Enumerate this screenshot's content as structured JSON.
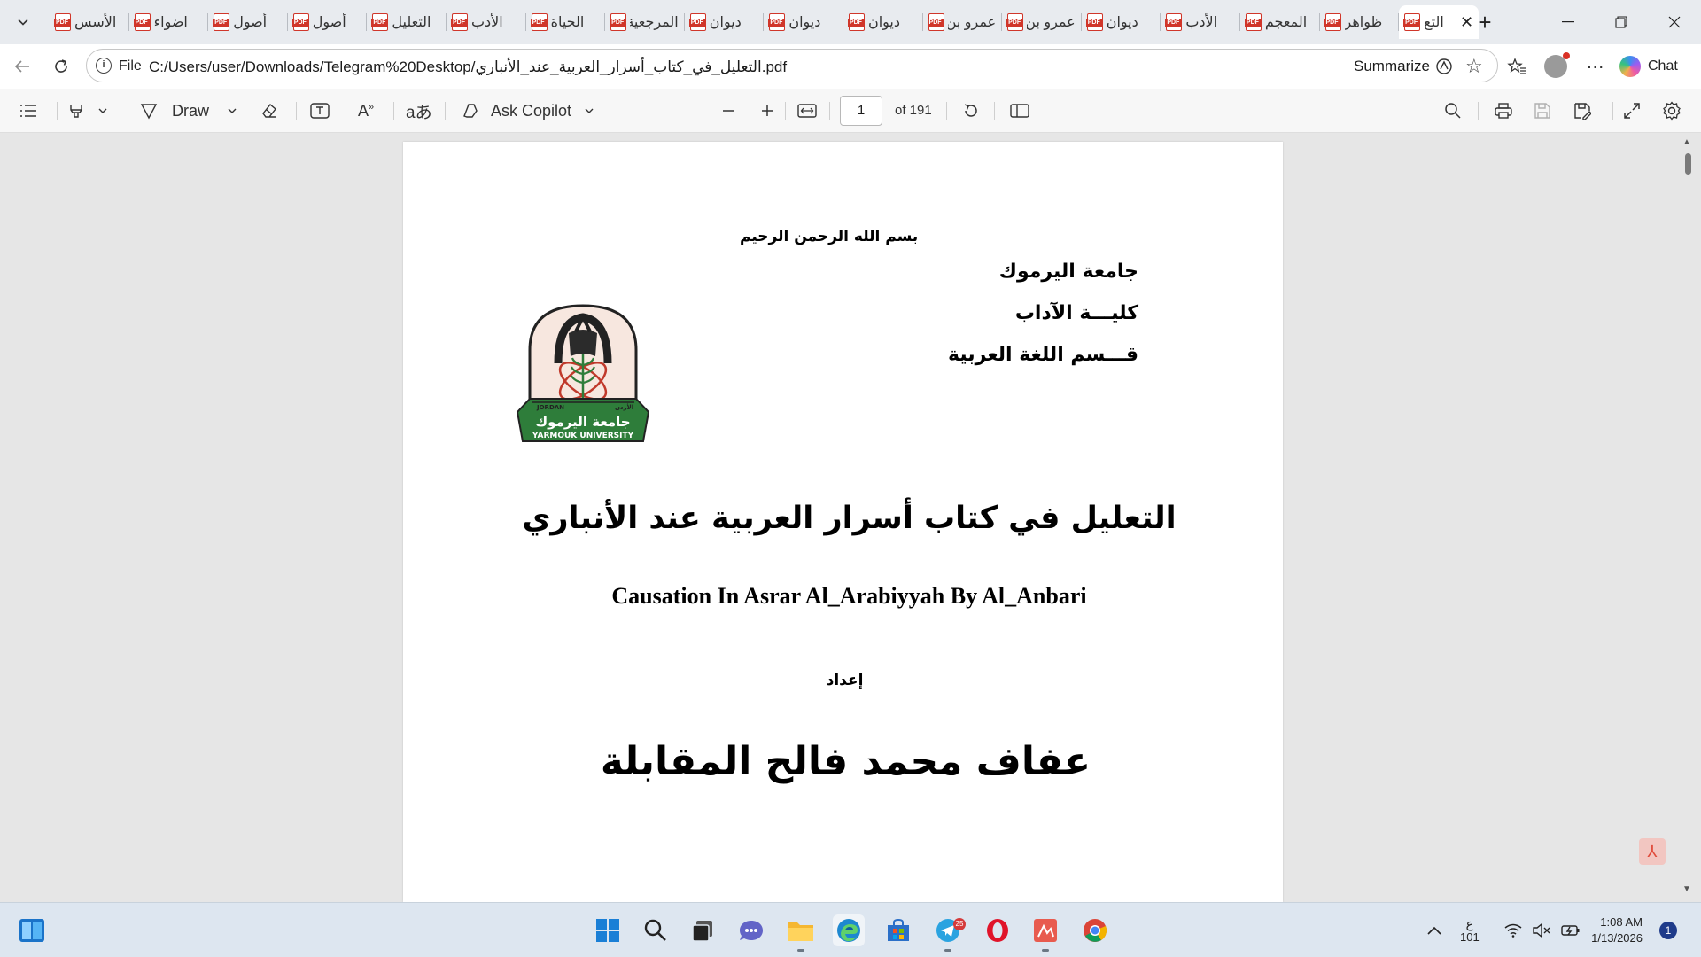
{
  "tabs": [
    {
      "title": "الأسس",
      "icon": "pdf-icon"
    },
    {
      "title": "اضواء",
      "icon": "pdf-icon"
    },
    {
      "title": "أصول",
      "icon": "pdf-icon"
    },
    {
      "title": "أصول",
      "icon": "pdf-icon"
    },
    {
      "title": "التعليل",
      "icon": "pdf-icon"
    },
    {
      "title": "الأدب",
      "icon": "pdf-icon"
    },
    {
      "title": "الحياة",
      "icon": "pdf-icon"
    },
    {
      "title": "المرجعية",
      "icon": "pdf-icon"
    },
    {
      "title": "ديوان",
      "icon": "pdf-icon"
    },
    {
      "title": "ديوان",
      "icon": "pdf-icon"
    },
    {
      "title": "ديوان",
      "icon": "pdf-icon"
    },
    {
      "title": "عمرو بن",
      "icon": "pdf-icon"
    },
    {
      "title": "عمرو بن",
      "icon": "pdf-icon"
    },
    {
      "title": "ديوان",
      "icon": "pdf-icon"
    },
    {
      "title": "الأدب",
      "icon": "pdf-icon"
    },
    {
      "title": "المعجم",
      "icon": "pdf-icon"
    },
    {
      "title": "ظواهر",
      "icon": "pdf-icon"
    },
    {
      "title": "التع",
      "icon": "pdf-icon",
      "active": true
    }
  ],
  "address": {
    "scheme_label": "File",
    "url": "C:/Users/user/Downloads/Telegram%20Desktop/التعليل_في_كتاب_أسرار_العربية_عند_الأنباري.pdf",
    "summarize_label": "Summarize",
    "chat_label": "Chat"
  },
  "pdf_toolbar": {
    "draw_label": "Draw",
    "ask_copilot_label": "Ask Copilot",
    "current_page": "1",
    "page_total_label": "of 191"
  },
  "document": {
    "basmala": "بسم الله الرحمن الرحيم",
    "university": "جامعة اليرموك",
    "faculty": "كليـــة الآداب",
    "department": "قـــسم اللغة العربية",
    "logo_text_arabic": "جامعة اليرموك",
    "logo_text_english": "YARMOUK UNIVERSITY",
    "logo_text_jordan": "JORDAN",
    "logo_text_jordan_ar": "الأردن",
    "title_arabic": "التعليل في كتاب أسرار العربية عند الأنباري",
    "title_english": "Causation In Asrar Al_Arabiyyah By Al_Anbari",
    "prepared_by_label": "إعداد",
    "author": "عفاف محمد فالح المقابلة"
  },
  "taskbar": {
    "pinned": [
      "start-icon",
      "search-icon",
      "task-view-icon",
      "chat-meet-icon",
      "file-explorer-icon",
      "edge-icon",
      "store-icon",
      "telegram-icon",
      "opera-icon",
      "pdf-reader-icon",
      "chrome-icon"
    ],
    "telegram_badge": "25",
    "ime_primary": "ع",
    "ime_secondary": "101",
    "time": "1:08 AM",
    "date": "1/13/2026",
    "notification_count": "1"
  },
  "colors": {
    "accent": "#1f6fcf",
    "logo_green": "#2e7d3a",
    "logo_red": "#c0392b",
    "logo_bg": "#f7e7df"
  }
}
